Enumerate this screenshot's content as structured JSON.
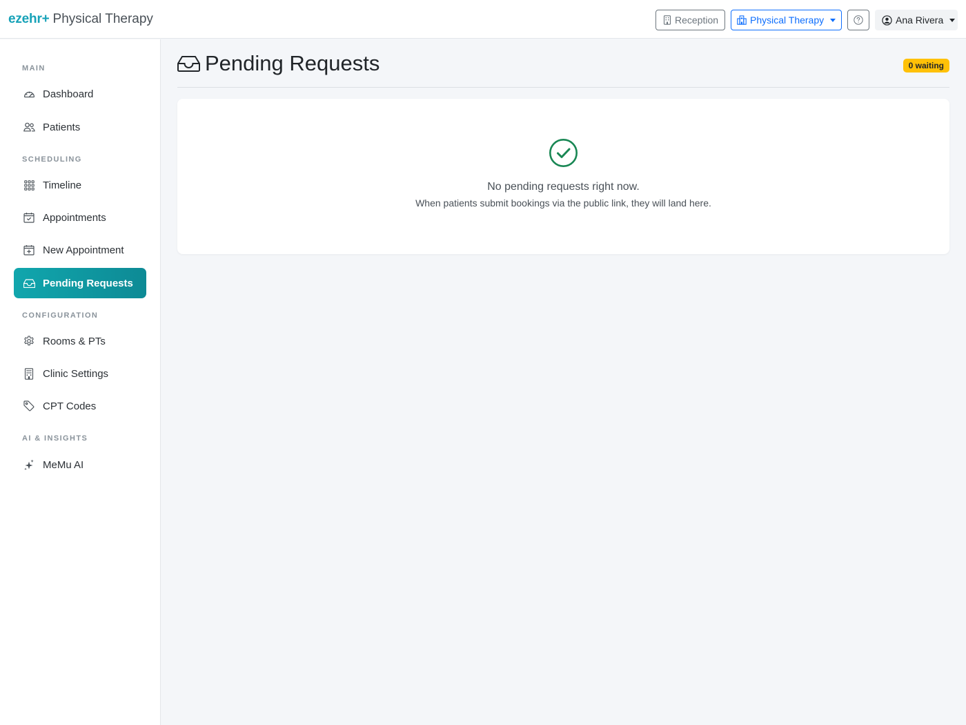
{
  "brand": {
    "logo": "ezehr+",
    "subtitle": "Physical Therapy"
  },
  "header": {
    "reception_label": "Reception",
    "clinic_label": "Physical Therapy",
    "user_name": "Ana Rivera"
  },
  "sidebar": {
    "sections": {
      "main": "MAIN",
      "scheduling": "SCHEDULING",
      "configuration": "CONFIGURATION",
      "ai": "AI & INSIGHTS"
    },
    "items": {
      "dashboard": "Dashboard",
      "patients": "Patients",
      "timeline": "Timeline",
      "appointments": "Appointments",
      "new_appointment": "New Appointment",
      "pending_requests": "Pending Requests",
      "rooms": "Rooms & PTs",
      "clinic_settings": "Clinic Settings",
      "cpt_codes": "CPT Codes",
      "memu_ai": "MeMu AI"
    },
    "active_item": "pending_requests"
  },
  "main": {
    "title": "Pending Requests",
    "waiting_badge": "0 waiting",
    "empty_title": "No pending requests right now.",
    "empty_subtitle": "When patients submit bookings via the public link, they will land here."
  },
  "colors": {
    "brand": "#17a2b8",
    "active_nav": "#0d8a95",
    "badge": "#ffc107",
    "success": "#198754",
    "primary": "#0d6efd"
  }
}
